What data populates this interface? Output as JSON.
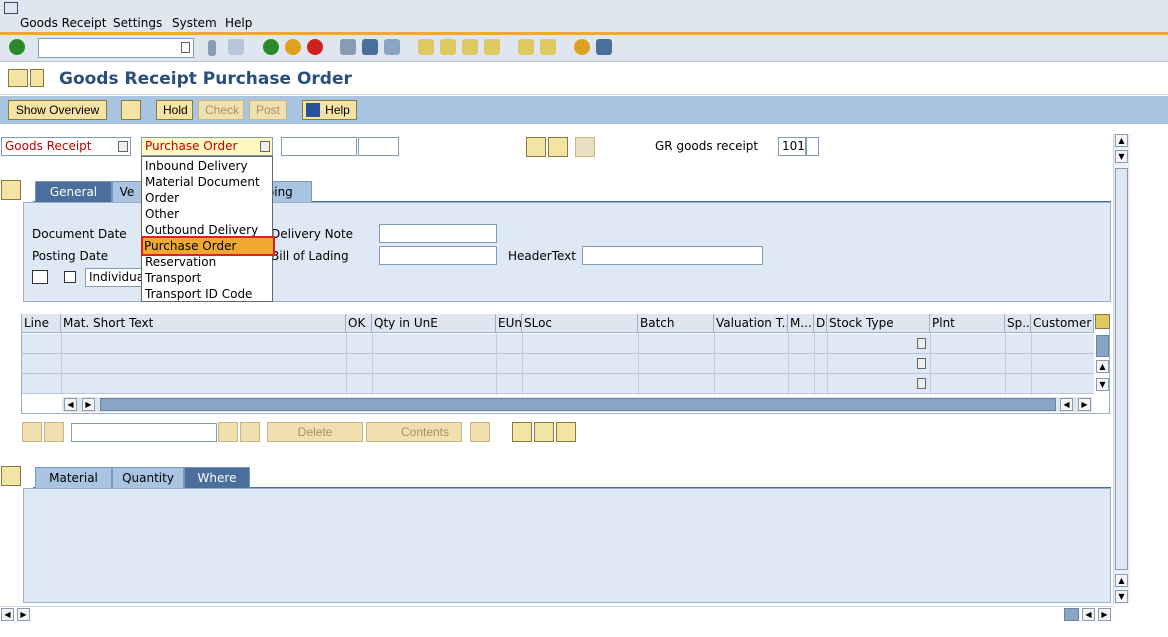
{
  "menu": {
    "items": [
      "Goods Receipt",
      "Settings",
      "System",
      "Help"
    ]
  },
  "title": "Goods Receipt Purchase Order",
  "app_toolbar": {
    "show_overview": "Show Overview",
    "hold": "Hold",
    "check": "Check",
    "post": "Post",
    "help": "Help"
  },
  "selectors": {
    "action": "Goods Receipt",
    "reference": "Purchase Order",
    "gr_label": "GR goods receipt",
    "movement_type": "101"
  },
  "dropdown": {
    "options": [
      "Inbound Delivery",
      "Material Document",
      "Order",
      "Other",
      "Outbound Delivery",
      "Purchase Order",
      "Reservation",
      "Transport",
      "Transport ID Code"
    ],
    "selected": "Purchase Order"
  },
  "header_tabs": {
    "general": "General",
    "vendor_partial": "Ve",
    "shipping_partial": "pping"
  },
  "header_fields": {
    "document_date": "Document Date",
    "posting_date": "Posting Date",
    "delivery_note": "Delivery Note",
    "bill_of_lading": "Bill of Lading",
    "header_text": "HeaderText",
    "individual_slip_partial": "Individual"
  },
  "table": {
    "columns": [
      "Line",
      "Mat. Short Text",
      "OK",
      "Qty in UnE",
      "EUn",
      "SLoc",
      "Batch",
      "Valuation T...",
      "M...",
      "D",
      "Stock Type",
      "Plnt",
      "Sp...",
      "Customer"
    ]
  },
  "lower_toolbar": {
    "delete": "Delete",
    "contents": "Contents"
  },
  "detail_tabs": {
    "material": "Material",
    "quantity": "Quantity",
    "where": "Where"
  },
  "colors": {
    "accent": "#f0a830",
    "header_blue": "#2a4f7c",
    "toolbar_blue": "#a8c4e0",
    "highlight_red": "#e02020"
  }
}
